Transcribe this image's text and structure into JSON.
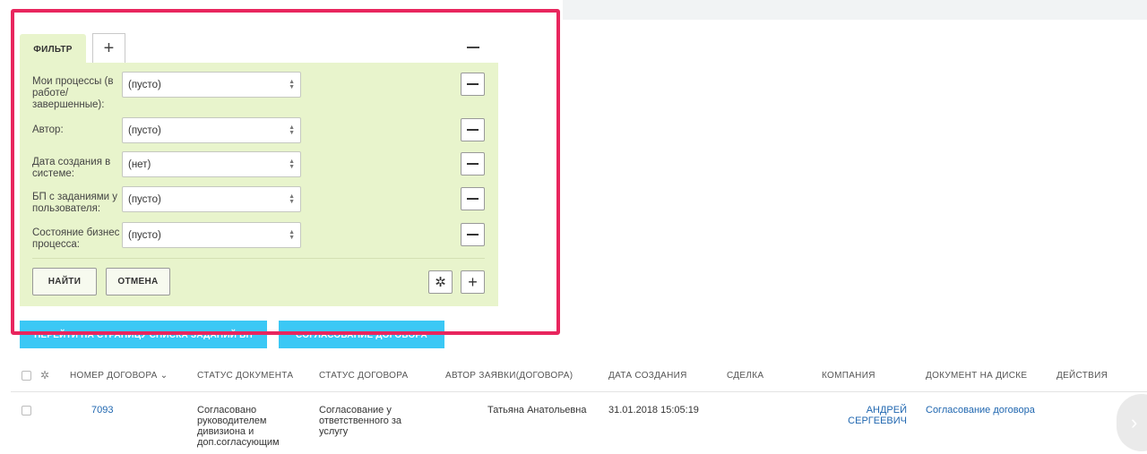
{
  "filter": {
    "tab_label": "ФИЛЬТР",
    "add_tab_icon": "+",
    "rows": [
      {
        "label": "Мои процессы (в работе/ завершенные):",
        "value": "(пусто)"
      },
      {
        "label": "Автор:",
        "value": "(пусто)"
      },
      {
        "label": "Дата создания в системе:",
        "value": "(нет)"
      },
      {
        "label": "БП с заданиями у пользователя:",
        "value": "(пусто)"
      },
      {
        "label": "Состояние бизнес процесса:",
        "value": "(пусто)"
      }
    ],
    "find_label": "НАЙТИ",
    "cancel_label": "ОТМЕНА",
    "settings_icon": "✲",
    "add_field_icon": "+"
  },
  "actions": {
    "go_to_tasks_label": "ПЕРЕЙТИ НА СТРАНИЦУ СПИСКА ЗАДАНИЙ БП",
    "contract_approval_label": "СОГЛАСОВАНИЕ ДОГОВОРА"
  },
  "table": {
    "columns": [
      "НОМЕР ДОГОВОРА",
      "СТАТУС ДОКУМЕНТА",
      "СТАТУС ДОГОВОРА",
      "АВТОР ЗАЯВКИ(ДОГОВОРА)",
      "ДАТА СОЗДАНИЯ",
      "СДЕЛКА",
      "КОМПАНИЯ",
      "ДОКУМЕНТ НА ДИСКЕ",
      "ДЕЙСТВИЯ"
    ],
    "sort_icon": "⌄",
    "rows": [
      {
        "number": "7093",
        "doc_status": "Согласовано руководителем дивизиона и доп.согласующим",
        "contract_status": "Согласование у ответственного за услугу",
        "author": "Татьяна Анатольевна",
        "created": "31.01.2018 15:05:19",
        "deal": "",
        "company": "АНДРЕЙ СЕРГЕЕВИЧ",
        "disk_doc": "Согласование договора"
      }
    ]
  },
  "colors": {
    "accent_blue": "#3bc8f5",
    "filter_bg": "#e8f4cc",
    "highlight": "#e8265e",
    "link": "#2067b0"
  },
  "icons": {
    "next_icon": "›"
  }
}
